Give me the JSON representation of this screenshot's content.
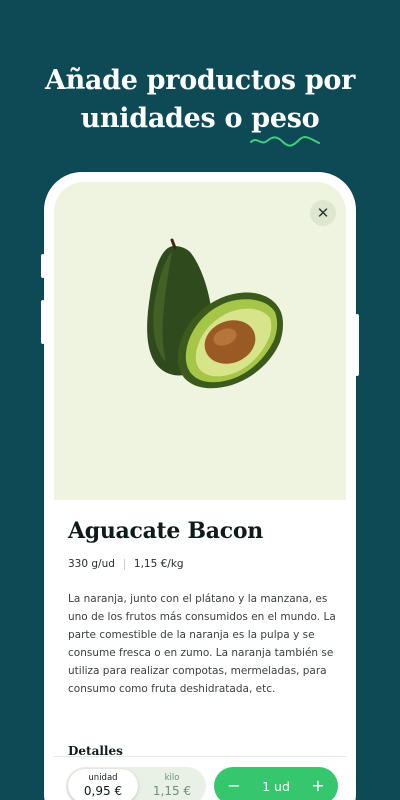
{
  "headline": {
    "line1": "Añade productos por",
    "line2_prefix": "unidades o ",
    "line2_highlight": "peso",
    "accent_color": "#3fcf79"
  },
  "product": {
    "name": "Aguacate Bacon",
    "weight": "330 g/ud",
    "price_per_kg": "1,15 €/kg",
    "description": "La naranja, junto con el plátano y la manzana, es uno de los frutos más consumidos en el mundo. La parte comestible de la naranja es la pulpa y se consume fresca o en zumo. La naranja también se utiliza para realizar compotas, mermeladas, para consumo como fruta deshidratada, etc.",
    "details_heading": "Detalles"
  },
  "close": {
    "symbol": "✕",
    "icon": "close-icon"
  },
  "unit_selector": {
    "selected": "unidad",
    "unit": {
      "label": "unidad",
      "price": "0,95 €"
    },
    "kilo": {
      "label": "kilo",
      "price": "1,15 €"
    }
  },
  "quantity": {
    "decrement": "−",
    "value": "1 ud",
    "increment": "+",
    "color": "#36c76e"
  },
  "colors": {
    "background": "#0e4a55",
    "hero_background": "#eef4df"
  }
}
